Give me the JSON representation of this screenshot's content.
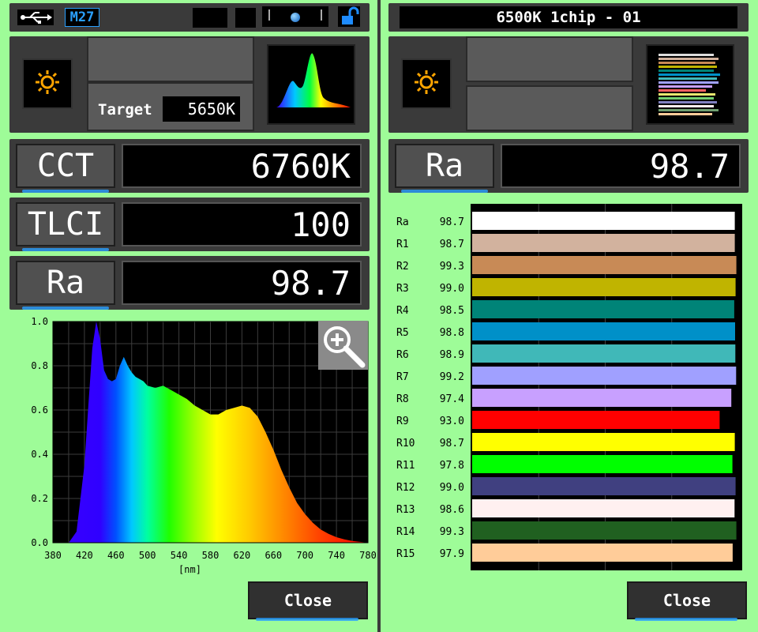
{
  "left": {
    "status_bar": {
      "usb_icon": "usb-icon",
      "memory_label": "M27",
      "lock_icon": "unlock-icon"
    },
    "target": {
      "label": "Target",
      "value": "5650K"
    },
    "measurements": [
      {
        "name": "CCT",
        "value": "6760K"
      },
      {
        "name": "TLCI",
        "value": "100"
      },
      {
        "name": "Ra",
        "value": "98.7"
      }
    ],
    "zoom_icon": "zoom-in-icon",
    "close_label": "Close"
  },
  "right": {
    "title": "6500K 1chip - 01",
    "measurement": {
      "name": "Ra",
      "value": "98.7"
    },
    "close_label": "Close"
  },
  "chart_data": [
    {
      "type": "area",
      "title": "",
      "xlabel": "[nm]",
      "ylabel": "",
      "xlim": [
        380,
        780
      ],
      "ylim": [
        0,
        1.0
      ],
      "x_ticks": [
        "380",
        "420",
        "460",
        "500",
        "540",
        "580",
        "620",
        "660",
        "700",
        "740",
        "780"
      ],
      "y_ticks": [
        "0.0",
        "0.2",
        "0.4",
        "0.6",
        "0.8",
        "1.0"
      ],
      "grid": true,
      "x": [
        380,
        390,
        400,
        410,
        420,
        425,
        430,
        435,
        440,
        445,
        450,
        455,
        460,
        465,
        470,
        475,
        480,
        485,
        490,
        495,
        500,
        510,
        520,
        530,
        540,
        550,
        560,
        570,
        580,
        590,
        600,
        610,
        620,
        630,
        640,
        650,
        660,
        670,
        680,
        690,
        700,
        710,
        720,
        730,
        740,
        750,
        760,
        770,
        780
      ],
      "y": [
        0,
        0,
        0,
        0.05,
        0.35,
        0.62,
        0.88,
        1.0,
        0.92,
        0.78,
        0.74,
        0.73,
        0.74,
        0.8,
        0.84,
        0.8,
        0.77,
        0.75,
        0.74,
        0.73,
        0.71,
        0.7,
        0.71,
        0.69,
        0.67,
        0.65,
        0.62,
        0.6,
        0.58,
        0.58,
        0.6,
        0.61,
        0.62,
        0.61,
        0.57,
        0.5,
        0.42,
        0.33,
        0.25,
        0.18,
        0.13,
        0.09,
        0.06,
        0.04,
        0.025,
        0.015,
        0.008,
        0.004,
        0
      ]
    },
    {
      "type": "bar",
      "title": "",
      "orientation": "horizontal",
      "categories": [
        "Ra",
        "R1",
        "R2",
        "R3",
        "R4",
        "R5",
        "R6",
        "R7",
        "R8",
        "R9",
        "R10",
        "R11",
        "R12",
        "R13",
        "R14",
        "R15"
      ],
      "values": [
        98.7,
        98.7,
        99.3,
        99.0,
        98.5,
        98.8,
        98.9,
        99.2,
        97.4,
        93.0,
        98.7,
        97.8,
        99.0,
        98.6,
        99.3,
        97.9
      ],
      "value_labels": [
        "98.7",
        "98.7",
        "99.3",
        "99.0",
        "98.5",
        "98.8",
        "98.9",
        "99.2",
        "97.4",
        "93.0",
        "98.7",
        "97.8",
        "99.0",
        "98.6",
        "99.3",
        "97.9"
      ],
      "colors": [
        "#ffffff",
        "#d2b29e",
        "#c88a56",
        "#c0b400",
        "#008478",
        "#0090c8",
        "#40b8b8",
        "#a0a0ff",
        "#c8a0ff",
        "#ff0000",
        "#ffff00",
        "#00ff00",
        "#404080",
        "#fff0f0",
        "#206020",
        "#ffcc99"
      ],
      "xlim": [
        0,
        100
      ],
      "grid": true
    }
  ]
}
